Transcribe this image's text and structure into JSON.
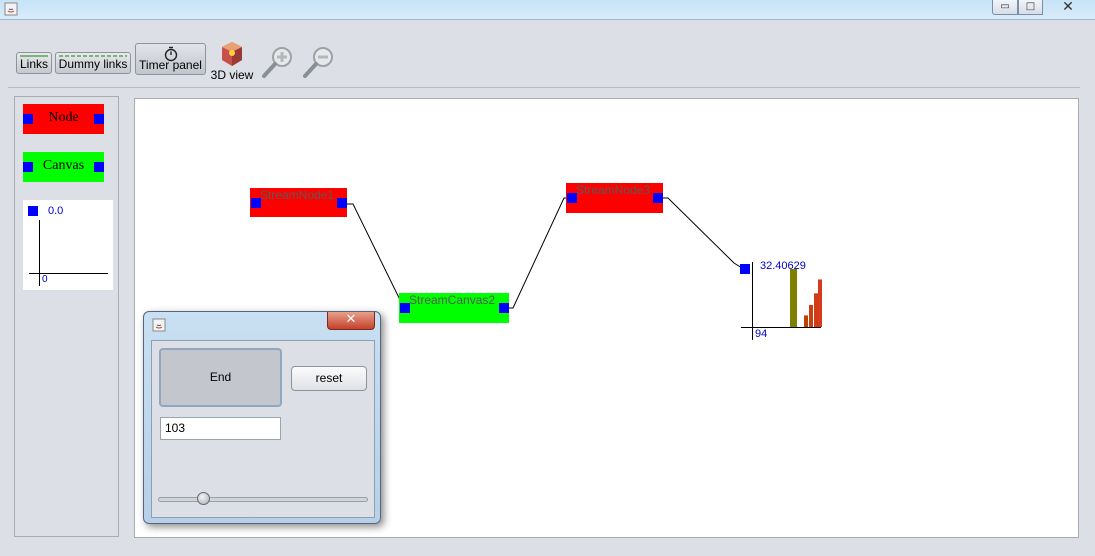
{
  "toolbar": {
    "links_label": "Links",
    "dummy_links_label": "Dummy links",
    "timer_panel_label": "Timer panel",
    "view3d_label": "3D view",
    "zoom_in_icon": "zoom-in-icon",
    "zoom_out_icon": "zoom-out-icon"
  },
  "palette": {
    "node_label": "Node",
    "canvas_label": "Canvas",
    "chart_value": "0.0",
    "chart_axis": "0"
  },
  "canvas": {
    "nodes": {
      "stream_node_1": "StreamNode1",
      "stream_node_3": "StreamNode3",
      "stream_canvas_2": "StreamCanvas2"
    },
    "chart": {
      "value_label": "32.40629",
      "axis_label": "94",
      "bars": [
        1.0,
        0.2,
        0.38,
        0.58,
        0.82
      ],
      "bar_colors": [
        "#7f7f00",
        "#c04000",
        "#c84010",
        "#d03c18",
        "#d83a20"
      ]
    }
  },
  "timer_dialog": {
    "end_label": "End",
    "reset_label": "reset",
    "value": "103",
    "slider_level": 0.2
  },
  "colors": {
    "node": "#ff0000",
    "canvas": "#00ff00",
    "port": "#0000ff"
  }
}
